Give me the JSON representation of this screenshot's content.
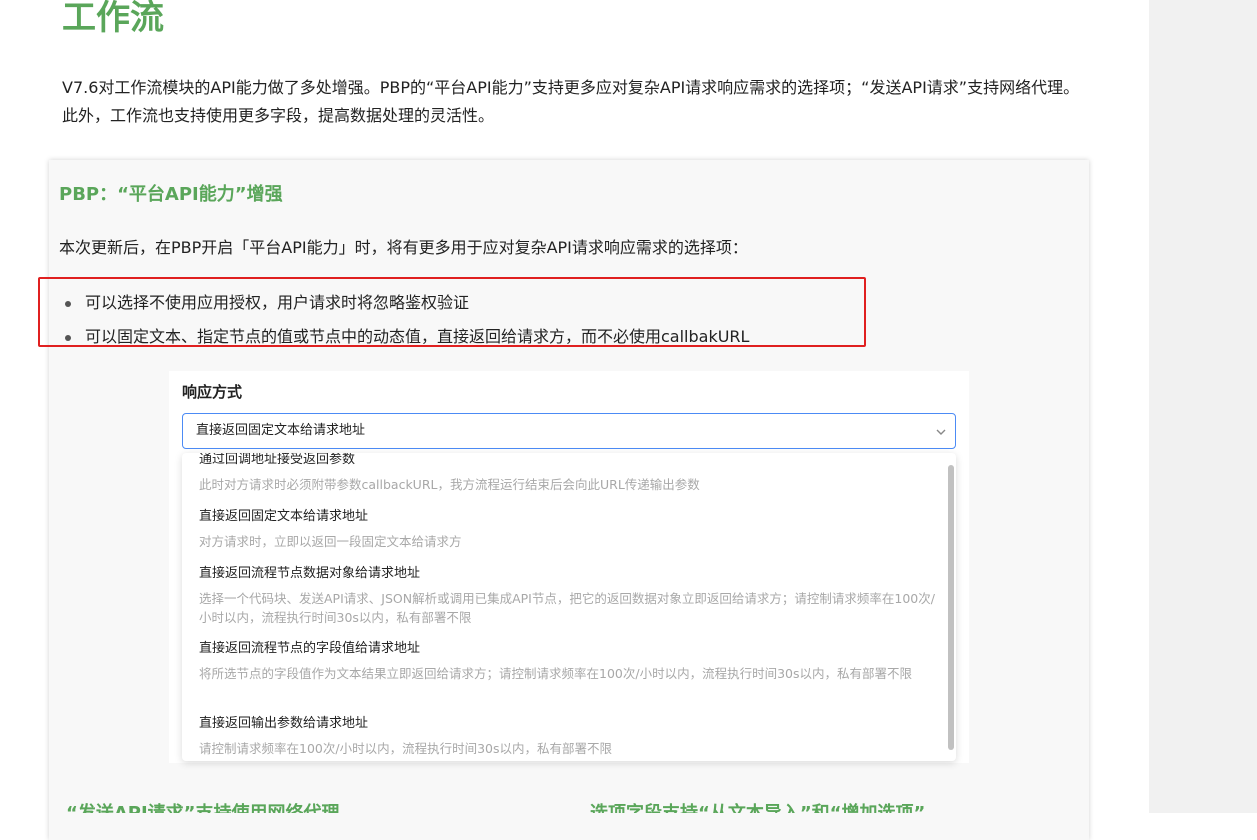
{
  "page": {
    "title": "工作流",
    "intro": "V7.6对工作流模块的API能力做了多处增强。PBP的“平台API能力”支持更多应对复杂API请求响应需求的选择项；“发送API请求”支持网络代理。此外，工作流也支持使用更多字段，提高数据处理的灵活性。"
  },
  "card": {
    "title": "PBP：“平台API能力”增强",
    "description": "本次更新后，在PBP开启「平台API能力」时，将有更多用于应对复杂API请求响应需求的选择项：",
    "bullets": [
      "可以选择不使用应用授权，用户请求时将忽略鉴权验证",
      "可以固定文本、指定节点的值或节点中的动态值，直接返回给请求方，而不必使用callbakURL"
    ]
  },
  "form": {
    "label": "响应方式",
    "selected_value": "直接返回固定文本给请求地址",
    "options": [
      {
        "title": "通过回调地址接受返回参数",
        "desc": "此时对方请求时必须附带参数callbackURL，我方流程运行结束后会向此URL传递输出参数"
      },
      {
        "title": "直接返回固定文本给请求地址",
        "desc": "对方请求时，立即以返回一段固定文本给请求方"
      },
      {
        "title": "直接返回流程节点数据对象给请求地址",
        "desc": "选择一个代码块、发送API请求、JSON解析或调用已集成API节点，把它的返回数据对象立即返回给请求方；请控制请求频率在100次/小时以内，流程执行时间30s以内，私有部署不限"
      },
      {
        "title": "直接返回流程节点的字段值给请求地址",
        "desc": "将所选节点的字段值作为文本结果立即返回给请求方；请控制请求频率在100次/小时以内，流程执行时间30s以内，私有部署不限"
      },
      {
        "title": "直接返回输出参数给请求地址",
        "desc": "请控制请求频率在100次/小时以内，流程执行时间30s以内，私有部署不限"
      }
    ]
  },
  "cut_off_headings": {
    "left": "“发送API请求”支持使用网络代理",
    "right": "选项字段支持“从文本导入”和“增加选项”"
  },
  "colors": {
    "heading_green": "#5aa65a",
    "highlight_red": "#e02020",
    "focus_blue": "#4c8bf5"
  },
  "icons": {
    "select_chevron": "chevron-down-icon"
  }
}
